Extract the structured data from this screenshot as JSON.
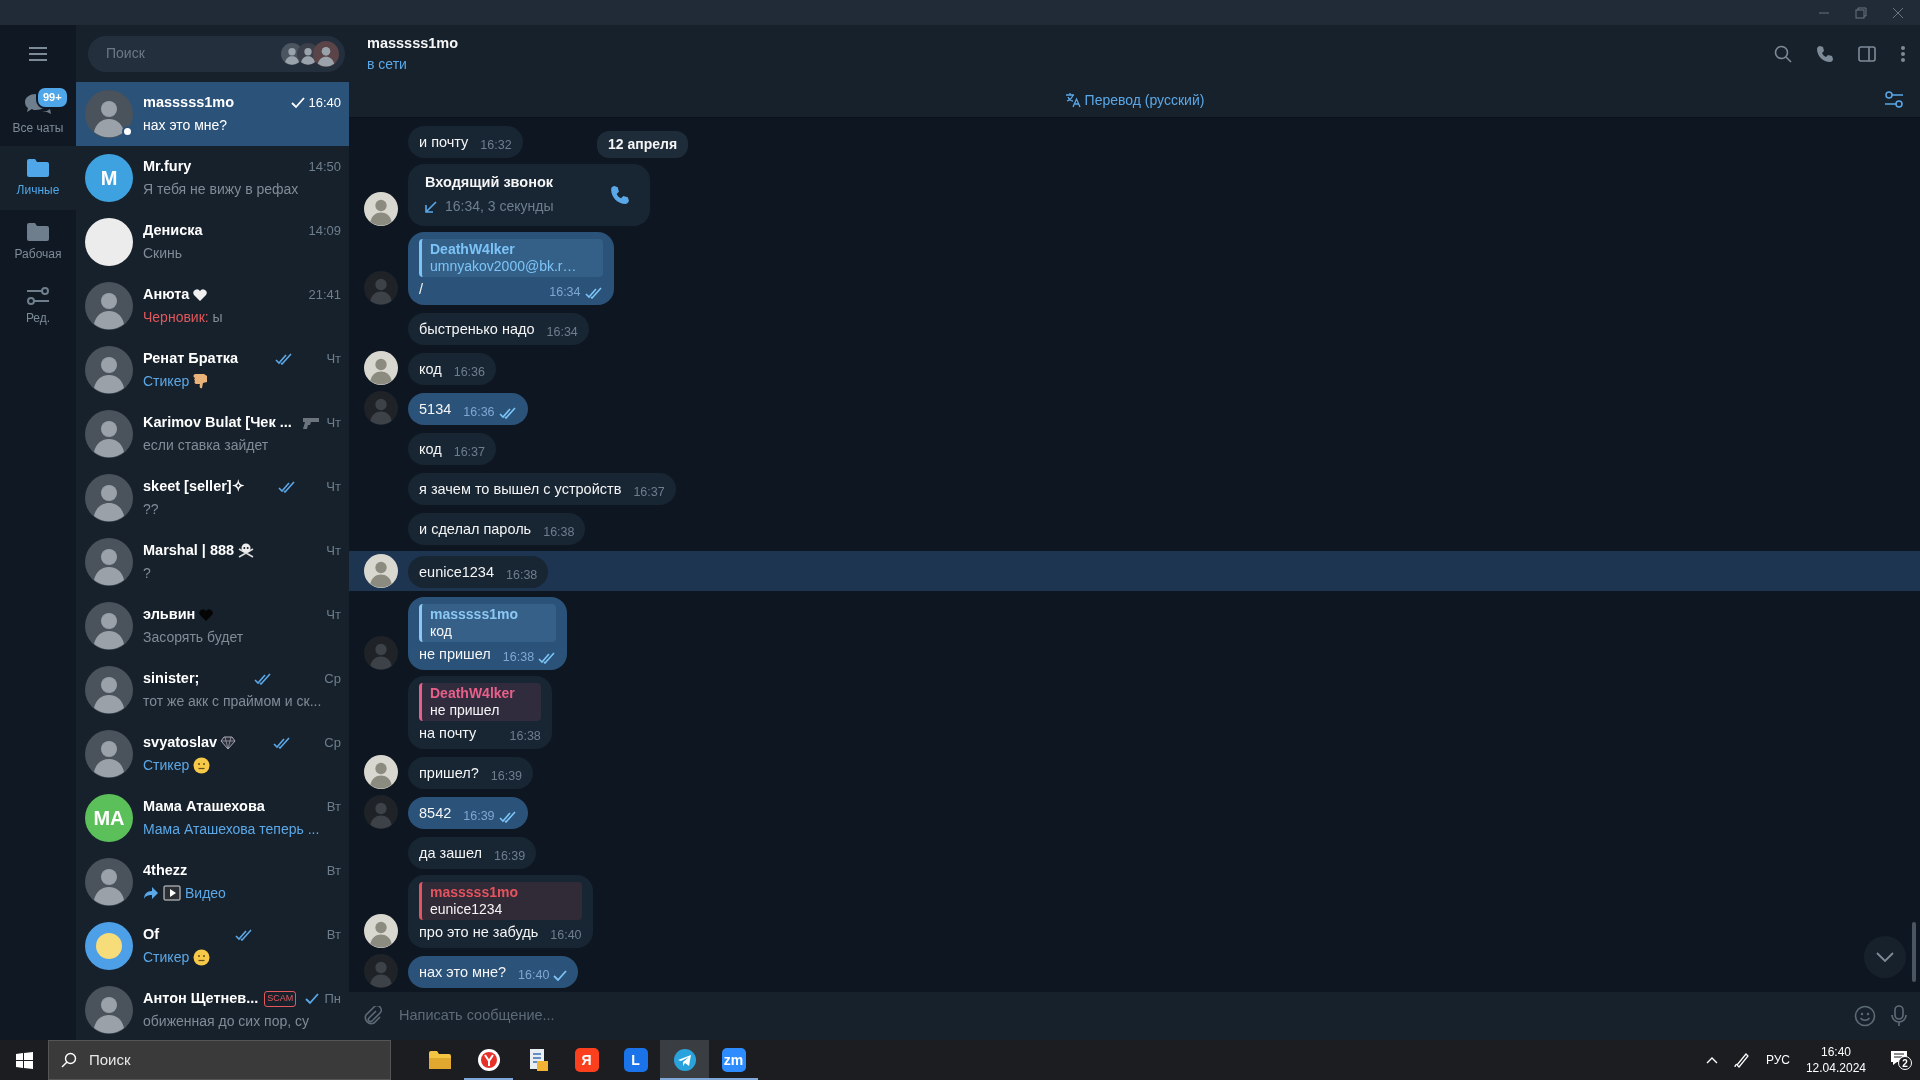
{
  "folders": [
    {
      "label": "Все чаты",
      "kind": "chats",
      "badge": "99+",
      "selected": false
    },
    {
      "label": "Личные",
      "kind": "folder",
      "selected": true
    },
    {
      "label": "Рабочая",
      "kind": "folder",
      "selected": false
    },
    {
      "label": "Ред.",
      "kind": "edit",
      "selected": false
    }
  ],
  "search": {
    "placeholder": "Поиск"
  },
  "chats": [
    {
      "name": "masssss1mo",
      "time": "16:40",
      "read": false,
      "preview": "нах это мне?",
      "avatar": {
        "kind": "photo"
      },
      "online": true,
      "selected": true
    },
    {
      "name": "Mr.fury",
      "time": "14:50",
      "preview": "Я тебя не вижу в рефах",
      "avatar": {
        "kind": "initials",
        "initials": "M",
        "color": "#3ea2e0"
      },
      "selected": false
    },
    {
      "name": "Дениска",
      "time": "14:09",
      "preview": "Скинь",
      "avatar": {
        "kind": "blank",
        "color": "#ececec"
      },
      "selected": false
    },
    {
      "name": "Анюта",
      "name_emoji": {
        "kind": "heart-light"
      },
      "time": "21:41",
      "draft_label": "Черновик:",
      "preview": "ы",
      "avatar": {
        "kind": "photo"
      },
      "selected": false
    },
    {
      "name": "Ренат Братка",
      "time": "Чт",
      "read": true,
      "preview": "Стикер",
      "accent": true,
      "preview_icons": [
        {
          "kind": "thumbs-down"
        }
      ],
      "avatar": {
        "kind": "photo"
      },
      "selected": false
    },
    {
      "name": "Karimov Bulat [Чек ...",
      "status_emoji": {
        "kind": "pistol"
      },
      "time": "Чт",
      "preview": "если ставка зайдет",
      "avatar": {
        "kind": "photo"
      },
      "selected": false
    },
    {
      "name": "skeet [seller]✧",
      "time": "Чт",
      "read": true,
      "preview": "??",
      "avatar": {
        "kind": "photo"
      },
      "selected": false
    },
    {
      "name": "Marshal | 888",
      "name_emoji": {
        "kind": "skull"
      },
      "time": "Чт",
      "preview": "?",
      "avatar": {
        "kind": "photo"
      },
      "selected": false
    },
    {
      "name": "эльвин",
      "name_emoji": {
        "kind": "heart-dark"
      },
      "time": "Чт",
      "preview": "Засорять будет",
      "avatar": {
        "kind": "photo"
      },
      "selected": false
    },
    {
      "name": "sinister;",
      "time": "Ср",
      "read": true,
      "preview": "тот же акк с праймом и ск...",
      "avatar": {
        "kind": "photo"
      },
      "selected": false
    },
    {
      "name": "svyatoslav",
      "name_emoji": {
        "kind": "gem"
      },
      "time": "Ср",
      "read": true,
      "preview": "Стикер",
      "accent": true,
      "preview_icons": [
        {
          "kind": "face"
        }
      ],
      "avatar": {
        "kind": "photo"
      },
      "selected": false
    },
    {
      "name": "Мама Аташехова",
      "time": "Вт",
      "preview": "Мама Аташехова теперь ...",
      "accent": true,
      "avatar": {
        "kind": "initials",
        "initials": "MA",
        "color": "#5bc05a"
      },
      "selected": false
    },
    {
      "name": "4thezz",
      "time": "Вт",
      "preview": "Видео",
      "accent": true,
      "preview_icons": [
        {
          "kind": "forward"
        },
        {
          "kind": "video"
        }
      ],
      "avatar": {
        "kind": "photo"
      },
      "selected": false
    },
    {
      "name": "Of",
      "time": "Вт",
      "read": true,
      "preview": "Стикер",
      "accent": true,
      "preview_icons": [
        {
          "kind": "face"
        }
      ],
      "avatar": {
        "kind": "face",
        "color": "#4d9fe8"
      },
      "selected": false
    },
    {
      "name": "Антон Щетнев...",
      "badge": "SCAM",
      "time": "Пн",
      "read": false,
      "preview": "обиженная до сих пор, су",
      "avatar": {
        "kind": "photo"
      },
      "selected": false
    }
  ],
  "header": {
    "name": "masssss1mo",
    "status": "в сети"
  },
  "translate_bar": {
    "label": "Перевод (русский)"
  },
  "date_badge": "12 апреля",
  "messages": [
    {
      "kind": "text",
      "outgoing": false,
      "text": "и почту",
      "time": "16:32",
      "avatar": false,
      "selected": false
    },
    {
      "kind": "call",
      "outgoing": false,
      "title": "Входящий звонок",
      "detail": "16:34, 3 секунды",
      "avatar": true,
      "selected": false
    },
    {
      "kind": "text",
      "outgoing": true,
      "reply": {
        "author": "DeathW4lker",
        "text": "umnyakov2000@bk.r…",
        "color": "#7cc4f8",
        "link": true
      },
      "text": "/",
      "time": "16:34",
      "read": true,
      "avatar": true,
      "selected": false
    },
    {
      "kind": "text",
      "outgoing": false,
      "text": "быстренько надо",
      "time": "16:34",
      "avatar": false,
      "selected": false
    },
    {
      "kind": "text",
      "outgoing": false,
      "text": "код",
      "time": "16:36",
      "avatar": true,
      "selected": false
    },
    {
      "kind": "text",
      "outgoing": true,
      "text": "5134",
      "time": "16:36",
      "read": true,
      "avatar": true,
      "selected": false
    },
    {
      "kind": "text",
      "outgoing": false,
      "text": "код",
      "time": "16:37",
      "avatar": false,
      "selected": false
    },
    {
      "kind": "text",
      "outgoing": false,
      "text": "я зачем то вышел с устройств",
      "time": "16:37",
      "avatar": false,
      "selected": false
    },
    {
      "kind": "text",
      "outgoing": false,
      "text": "и сделал пароль",
      "time": "16:38",
      "avatar": false,
      "selected": false
    },
    {
      "kind": "text",
      "outgoing": false,
      "text": "eunice1234",
      "time": "16:38",
      "avatar": true,
      "selected": true
    },
    {
      "kind": "text",
      "outgoing": true,
      "reply": {
        "author": "masssss1mo",
        "text": "код",
        "color": "#8cc8f5",
        "link": false
      },
      "text": "не пришел",
      "time": "16:38",
      "read": true,
      "avatar": true,
      "selected": false
    },
    {
      "kind": "text",
      "outgoing": false,
      "reply": {
        "author": "DeathW4lker",
        "text": "не пришел",
        "color": "#e8608a",
        "link": false
      },
      "text": "на почту",
      "time": "16:38",
      "avatar": false,
      "selected": false
    },
    {
      "kind": "text",
      "outgoing": false,
      "text": "пришел?",
      "time": "16:39",
      "avatar": true,
      "selected": false
    },
    {
      "kind": "text",
      "outgoing": true,
      "text": "8542",
      "time": "16:39",
      "read": true,
      "avatar": true,
      "selected": false
    },
    {
      "kind": "text",
      "outgoing": false,
      "text": "да зашел",
      "time": "16:39",
      "avatar": false,
      "selected": false
    },
    {
      "kind": "text",
      "outgoing": false,
      "reply": {
        "author": "masssss1mo",
        "text": "eunice1234",
        "color": "#e5535e",
        "link": false
      },
      "text": "про это не забудь",
      "time": "16:40",
      "avatar": true,
      "selected": false
    },
    {
      "kind": "text",
      "outgoing": true,
      "text": "нах это мне?",
      "time": "16:40",
      "read": false,
      "avatar": true,
      "selected": false
    }
  ],
  "composer": {
    "placeholder": "Написать сообщение..."
  },
  "taskbar": {
    "search_placeholder": "Поиск",
    "apps": [
      {
        "kind": "folder",
        "running": false,
        "selected": false
      },
      {
        "kind": "browser",
        "running": true,
        "selected": false
      },
      {
        "kind": "document",
        "running": false,
        "selected": false
      },
      {
        "kind": "tile",
        "label": "Я",
        "color": "#fc3f1d",
        "running": false,
        "selected": false
      },
      {
        "kind": "tile",
        "label": "L",
        "color": "#1a73e8",
        "running": false,
        "selected": false
      },
      {
        "kind": "telegram",
        "running": true,
        "selected": true
      },
      {
        "kind": "tile",
        "label": "zm",
        "color": "#2d8cff",
        "running": true,
        "selected": false
      }
    ],
    "language": "РУС",
    "time": "16:40",
    "date": "12.04.2024",
    "notifications": "2"
  }
}
